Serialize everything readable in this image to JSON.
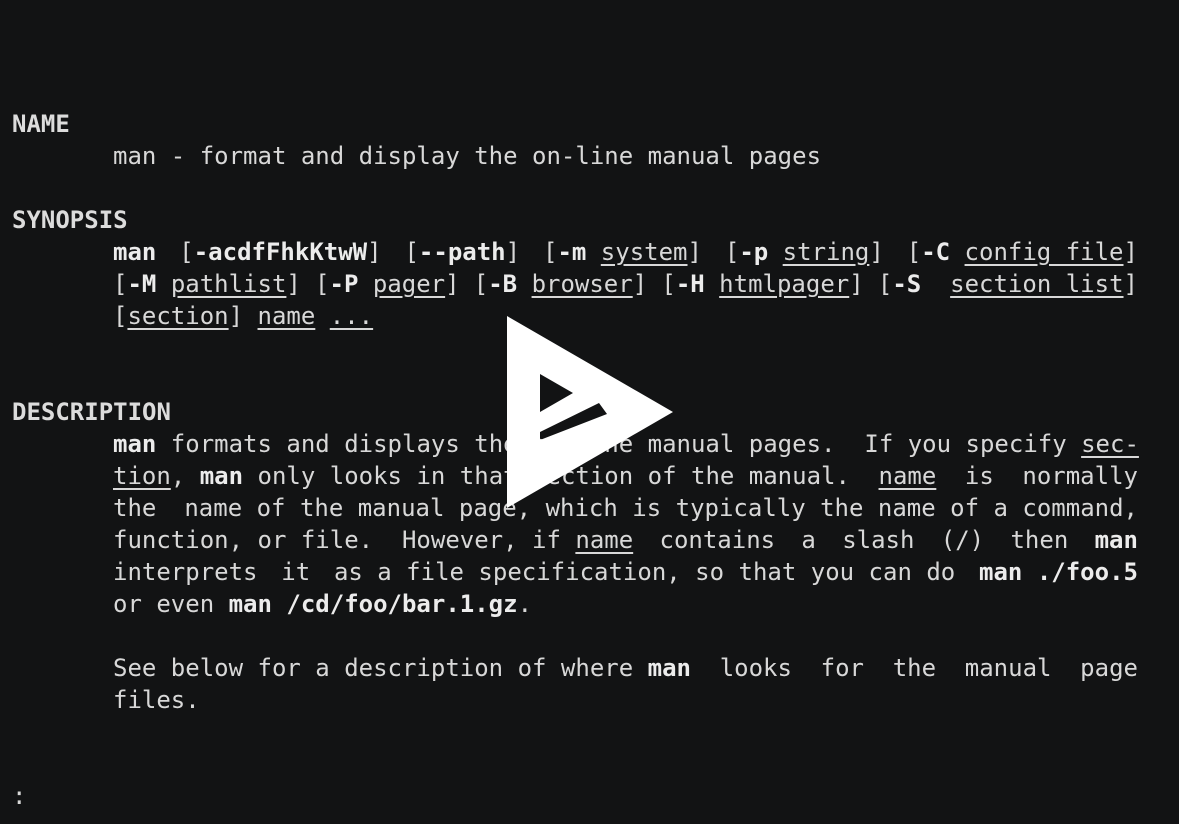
{
  "man": {
    "name_heading": "NAME",
    "name_line": "man - format and display the on-line manual pages",
    "synopsis_heading": "SYNOPSIS",
    "synopsis": {
      "man": "man",
      "opt_acdf": "-acdfFhkKtwW",
      "opt_path": "--path",
      "opt_m": "-m",
      "arg_system": "system",
      "opt_p": "-p",
      "arg_string": "string",
      "opt_C": "-C",
      "arg_config_file": "config_file",
      "opt_M": "-M",
      "arg_pathlist": "pathlist",
      "opt_P": "-P",
      "arg_pager": "pager",
      "opt_B": "-B",
      "arg_browser": "browser",
      "opt_H": "-H",
      "arg_htmlpager": "htmlpager",
      "opt_S": "-S",
      "arg_section_list": "section_list",
      "arg_section": "section",
      "arg_name": "name",
      "arg_ellipsis": "..."
    },
    "description_heading": "DESCRIPTION",
    "description": {
      "p1_l1_man": "man",
      "p1_l1_text": " formats and displays the on-line manual pages.  If you specify ",
      "p1_l1_sec": "sec-",
      "p1_l2_tion": "tion",
      "p1_l2_comma": ", ",
      "p1_l2_man": "man",
      "p1_l2_text": " only looks in that section of the manual.",
      "p1_l2_name": "name",
      "p1_l2_is": "is",
      "p1_l2_normally": "normally",
      "p1_l3_words": [
        "the",
        "name of the manual page, which is typically the name of a command,"
      ],
      "p1_l4_words_a": "function, or file.  However, if ",
      "p1_l4_name": "name",
      "p1_l4_contains": "contains",
      "p1_l4_a": "a",
      "p1_l4_slash": "slash",
      "p1_l4_paren": "(/)",
      "p1_l4_then": "then",
      "p1_l4_man": "man",
      "p1_l5_interprets": "interprets",
      "p1_l5_it": "it",
      "p1_l5_rest": "as a file specification, so that you can do",
      "p1_l5_cmd": "man ./foo.5",
      "p1_l6_oreven": "or even ",
      "p1_l6_cmd": "man /cd/foo/bar.1.gz",
      "p1_l6_period": ".",
      "p2_l1_text": "See below for a description of where ",
      "p2_l1_man": "man",
      "p2_l1_looks": "looks",
      "p2_l1_for": "for",
      "p2_l1_the": "the",
      "p2_l1_manual": "manual",
      "p2_l1_page": "page",
      "p2_l2": "files."
    },
    "prompt": ":"
  },
  "overlay": {
    "icon": "play-icon",
    "color": "#ffffff"
  },
  "colors": {
    "background": "#121314",
    "text": "#d8d8d8"
  }
}
